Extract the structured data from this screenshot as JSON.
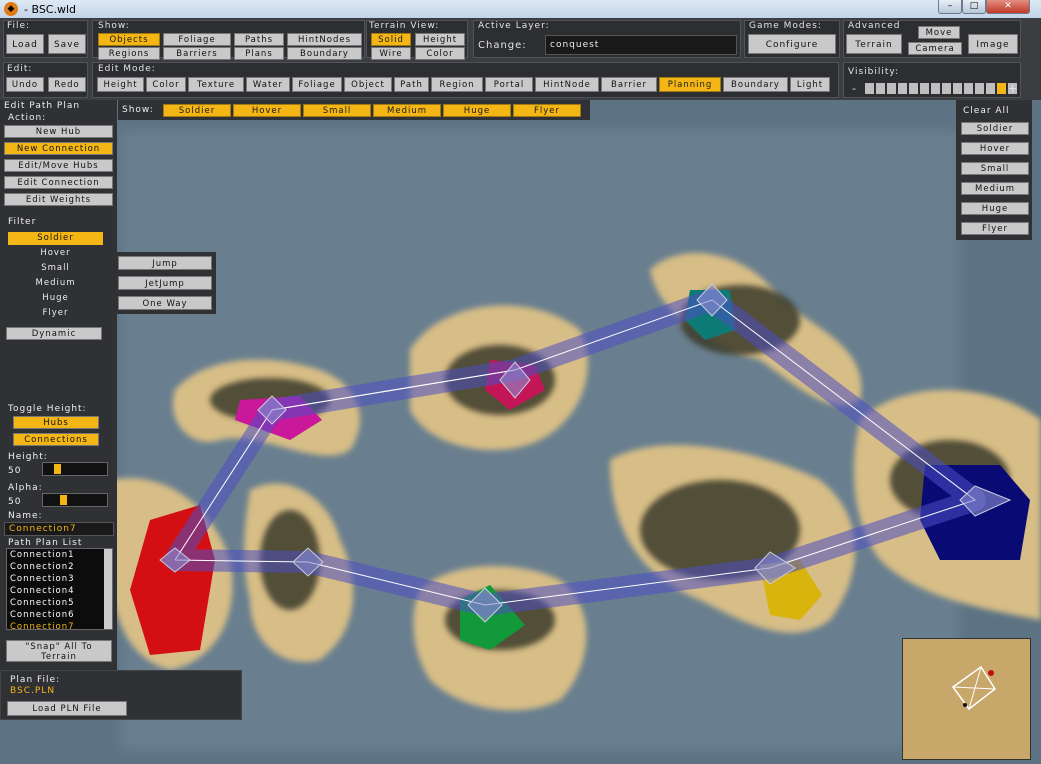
{
  "window": {
    "title": "- BSC.wld",
    "app_icon": "flame-app-icon"
  },
  "toolbar": {
    "file": {
      "label": "File:",
      "load": "Load",
      "save": "Save"
    },
    "show": {
      "label": "Show:",
      "buttons": [
        "Objects",
        "Foliage",
        "Paths",
        "HintNodes",
        "Regions",
        "Barriers",
        "Plans",
        "Boundary"
      ],
      "active": "Objects"
    },
    "terrain_view": {
      "label": "Terrain View:",
      "buttons": [
        "Solid",
        "Height",
        "Wire",
        "Color"
      ],
      "active": "Solid"
    },
    "active_layer": {
      "label": "Active Layer:",
      "change": "Change:",
      "value": "conquest"
    },
    "game_modes": {
      "label": "Game Modes:",
      "configure": "Configure"
    },
    "advanced": {
      "label": "Advanced",
      "terrain": "Terrain",
      "move": "Move",
      "camera": "Camera",
      "image": "Image"
    },
    "edit": {
      "label": "Edit:",
      "undo": "Undo",
      "redo": "Redo"
    },
    "edit_mode": {
      "label": "Edit Mode:",
      "buttons": [
        "Height",
        "Color",
        "Texture",
        "Water",
        "Foliage",
        "Object",
        "Path",
        "Region",
        "Portal",
        "HintNode",
        "Barrier",
        "Planning",
        "Boundary",
        "Light"
      ],
      "active": "Planning"
    },
    "visibility": {
      "label": "Visibility:",
      "minus": "-",
      "plus": "+",
      "cells": 14,
      "level": 13
    }
  },
  "edit_panel": {
    "title": "Edit Path Plan",
    "action_label": "Action:",
    "actions": [
      "New Hub",
      "New Connection",
      "Edit/Move Hubs",
      "Edit Connection",
      "Edit Weights"
    ],
    "active_action": "New Connection",
    "filter_label": "Filter",
    "filters": [
      "Soldier",
      "Hover",
      "Small",
      "Medium",
      "Huge",
      "Flyer"
    ],
    "active_filter": "Soldier",
    "dynamic": "Dynamic",
    "toggle_height_label": "Toggle Height:",
    "hubs": "Hubs",
    "connections": "Connections",
    "height_label": "Height:",
    "height_value": "50",
    "alpha_label": "Alpha:",
    "alpha_value": "50",
    "name_label": "Name:",
    "name_value": "Connection7",
    "list_label": "Path Plan List",
    "list_items": [
      "Connection1",
      "Connection2",
      "Connection3",
      "Connection4",
      "Connection5",
      "Connection6",
      "Connection7"
    ],
    "selected_item": "Connection7",
    "snap_line1": "\"Snap\" All To",
    "snap_line2": "Terrain"
  },
  "plan_file": {
    "label": "Plan File:",
    "value": "BSC.PLN",
    "load": "Load PLN File"
  },
  "show_bar": {
    "label": "Show:",
    "items": [
      "Soldier",
      "Hover",
      "Small",
      "Medium",
      "Huge",
      "Flyer"
    ]
  },
  "jump_box": {
    "items": [
      "Jump",
      "JetJump",
      "One Way"
    ]
  },
  "right_panel": {
    "clear_all": "Clear All",
    "items": [
      "Soldier",
      "Hover",
      "Small",
      "Medium",
      "Huge",
      "Flyer"
    ]
  },
  "colors": {
    "accent": "#f3b615",
    "water": "#5d7384",
    "sand": "#d8c08a",
    "path_band": "#4d4fc4"
  }
}
